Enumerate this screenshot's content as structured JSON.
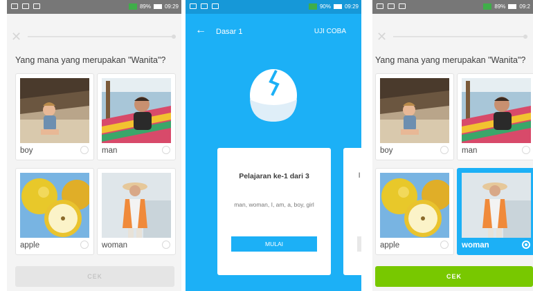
{
  "statusbar": {
    "left": {
      "battery_pct": "89%",
      "time": "09:29"
    },
    "middle": {
      "battery_pct": "90%",
      "time": "09:29"
    },
    "right": {
      "battery_pct": "89%",
      "time": "09:2"
    }
  },
  "quiz": {
    "question": "Yang mana yang merupakan \"Wanita\"?",
    "options": [
      {
        "label": "boy"
      },
      {
        "label": "man"
      },
      {
        "label": "apple"
      },
      {
        "label": "woman"
      }
    ],
    "check_label": "CEK"
  },
  "quiz_selected": {
    "question": "Yang mana yang merupakan \"Wanita\"?",
    "selected_label": "woman",
    "check_label": "CEK"
  },
  "lesson": {
    "back_label": "←",
    "title": "Dasar 1",
    "test_label": "UJI COBA",
    "card_title": "Pelajaran ke-1 dari 3",
    "card_words": "man, woman, I, am, a, boy, girl",
    "start_label": "MULAI"
  },
  "colors": {
    "accent_blue": "#1cb0f6",
    "check_green": "#78c800",
    "disabled_gray": "#e5e5e5"
  }
}
